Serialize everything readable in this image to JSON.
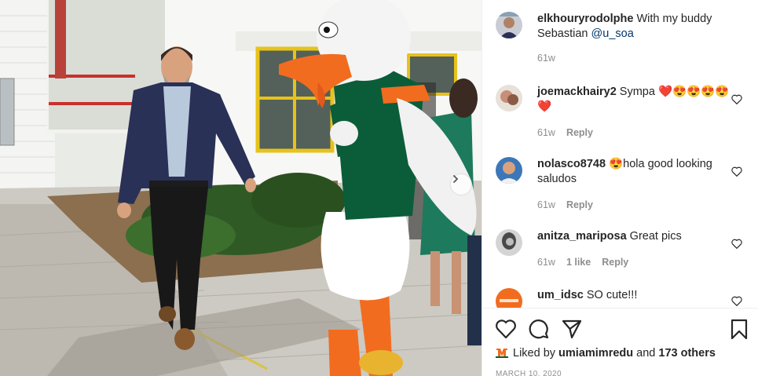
{
  "post": {
    "author": "elkhouryrodolphe",
    "caption_text": " With my buddy Sebastian ",
    "caption_mention": "@u_soa",
    "age": "61w"
  },
  "comments": [
    {
      "user": "joemackhairy2",
      "text": " Sympa ❤️😍😍😍😍❤️",
      "age": "61w",
      "reply": "Reply"
    },
    {
      "user": "nolasco8748",
      "text": " 😍hola good looking saludos",
      "age": "61w",
      "reply": "Reply"
    },
    {
      "user": "anitza_mariposa",
      "text": " Great pics",
      "age": "61w",
      "likes": "1 like",
      "reply": "Reply"
    },
    {
      "user": "um_idsc",
      "text": " SO cute!!!"
    }
  ],
  "likes": {
    "prefix": "Liked by ",
    "user": "umiamimredu",
    "middle": " and ",
    "others": "173 others"
  },
  "date": "MARCH 10, 2020",
  "colors": {
    "green": "#0b5d3a",
    "orange": "#f26c1f",
    "heart": "#ed4956",
    "link": "#00376b"
  },
  "icons": [
    "heart-icon",
    "comment-icon",
    "share-icon",
    "bookmark-icon",
    "chevron-right-icon"
  ]
}
